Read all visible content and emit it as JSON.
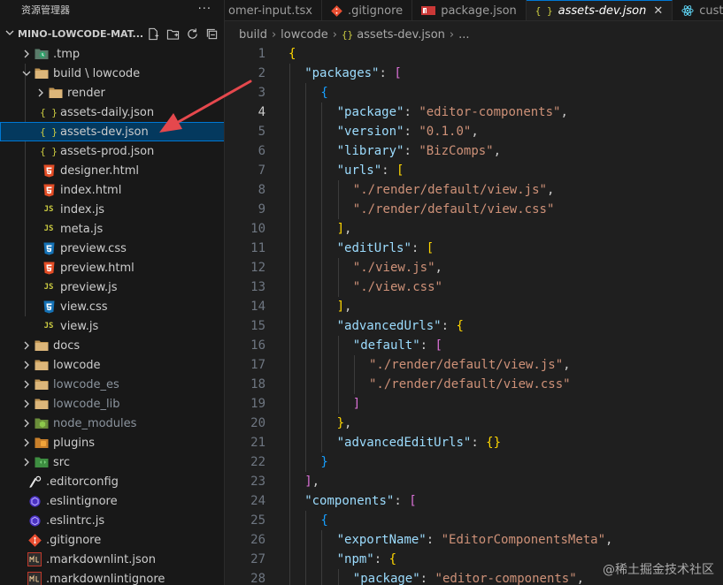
{
  "sidebar": {
    "title": "资源管理器",
    "more": "···",
    "root": "MINO-LOWCODE-MAT...",
    "items": [
      {
        "label": ".tmp",
        "level": 1,
        "icon": "tmp-folder-icon",
        "expanded": false,
        "dim": false
      },
      {
        "label": "build \\ lowcode",
        "level": 1,
        "icon": "folder-icon",
        "expanded": true,
        "dim": false
      },
      {
        "label": "render",
        "level": 2,
        "icon": "folder-icon",
        "expanded": false,
        "dim": false
      },
      {
        "label": "assets-daily.json",
        "level": 2,
        "icon": "json-icon",
        "dim": false
      },
      {
        "label": "assets-dev.json",
        "level": 2,
        "icon": "json-icon",
        "dim": false,
        "selected": true
      },
      {
        "label": "assets-prod.json",
        "level": 2,
        "icon": "json-icon",
        "dim": false
      },
      {
        "label": "designer.html",
        "level": 2,
        "icon": "html-icon",
        "dim": false
      },
      {
        "label": "index.html",
        "level": 2,
        "icon": "html-icon",
        "dim": false
      },
      {
        "label": "index.js",
        "level": 2,
        "icon": "js-icon",
        "dim": false
      },
      {
        "label": "meta.js",
        "level": 2,
        "icon": "js-icon",
        "dim": false
      },
      {
        "label": "preview.css",
        "level": 2,
        "icon": "css-icon",
        "dim": false
      },
      {
        "label": "preview.html",
        "level": 2,
        "icon": "html-icon",
        "dim": false
      },
      {
        "label": "preview.js",
        "level": 2,
        "icon": "js-icon",
        "dim": false
      },
      {
        "label": "view.css",
        "level": 2,
        "icon": "css-icon",
        "dim": false
      },
      {
        "label": "view.js",
        "level": 2,
        "icon": "js-icon",
        "dim": false
      },
      {
        "label": "docs",
        "level": 1,
        "icon": "folder-icon",
        "expanded": false,
        "dim": false
      },
      {
        "label": "lowcode",
        "level": 1,
        "icon": "folder-icon",
        "expanded": false,
        "dim": false
      },
      {
        "label": "lowcode_es",
        "level": 1,
        "icon": "folder-icon",
        "expanded": false,
        "dim": true
      },
      {
        "label": "lowcode_lib",
        "level": 1,
        "icon": "folder-icon",
        "expanded": false,
        "dim": true
      },
      {
        "label": "node_modules",
        "level": 1,
        "icon": "node-folder-icon",
        "expanded": false,
        "dim": true
      },
      {
        "label": "plugins",
        "level": 1,
        "icon": "plugin-folder-icon",
        "expanded": false,
        "dim": false
      },
      {
        "label": "src",
        "level": 1,
        "icon": "src-folder-icon",
        "expanded": false,
        "dim": false
      },
      {
        "label": ".editorconfig",
        "level": 1,
        "icon": "editorconfig-icon",
        "dim": false
      },
      {
        "label": ".eslintignore",
        "level": 1,
        "icon": "eslint-icon",
        "dim": false
      },
      {
        "label": ".eslintrc.js",
        "level": 1,
        "icon": "eslint-icon",
        "dim": false
      },
      {
        "label": ".gitignore",
        "level": 1,
        "icon": "git-icon",
        "dim": false
      },
      {
        "label": ".markdownlint.json",
        "level": 1,
        "icon": "markdownlint-icon",
        "dim": false
      },
      {
        "label": ".markdownlintignore",
        "level": 1,
        "icon": "markdownlint-icon",
        "dim": false
      }
    ]
  },
  "tabs": [
    {
      "label": "omer-input.tsx",
      "icon": "",
      "active": false
    },
    {
      "label": ".gitignore",
      "icon": "git-icon",
      "active": false
    },
    {
      "label": "package.json",
      "icon": "npm-icon",
      "active": false
    },
    {
      "label": "assets-dev.json",
      "icon": "json-icon",
      "active": true
    },
    {
      "label": "custo",
      "icon": "react-icon",
      "active": false
    }
  ],
  "breadcrumb": [
    "build",
    "lowcode",
    "assets-dev.json",
    "..."
  ],
  "editor": {
    "lines": [
      {
        "n": "1",
        "indent": 0,
        "tokens": [
          [
            "b1",
            "{"
          ]
        ]
      },
      {
        "n": "2",
        "indent": 1,
        "tokens": [
          [
            "k",
            "\"packages\""
          ],
          [
            "p",
            ": "
          ],
          [
            "b2",
            "["
          ]
        ]
      },
      {
        "n": "3",
        "indent": 2,
        "tokens": [
          [
            "b3",
            "{"
          ]
        ]
      },
      {
        "n": "4",
        "indent": 3,
        "tokens": [
          [
            "k",
            "\"package\""
          ],
          [
            "p",
            ": "
          ],
          [
            "s",
            "\"editor-components\""
          ],
          [
            "p",
            ","
          ]
        ]
      },
      {
        "n": "5",
        "indent": 3,
        "tokens": [
          [
            "k",
            "\"version\""
          ],
          [
            "p",
            ": "
          ],
          [
            "s",
            "\"0.1.0\""
          ],
          [
            "p",
            ","
          ]
        ]
      },
      {
        "n": "6",
        "indent": 3,
        "tokens": [
          [
            "k",
            "\"library\""
          ],
          [
            "p",
            ": "
          ],
          [
            "s",
            "\"BizComps\""
          ],
          [
            "p",
            ","
          ]
        ]
      },
      {
        "n": "7",
        "indent": 3,
        "tokens": [
          [
            "k",
            "\"urls\""
          ],
          [
            "p",
            ": "
          ],
          [
            "b1",
            "["
          ]
        ]
      },
      {
        "n": "8",
        "indent": 4,
        "tokens": [
          [
            "s",
            "\"./render/default/view.js\""
          ],
          [
            "p",
            ","
          ]
        ]
      },
      {
        "n": "9",
        "indent": 4,
        "tokens": [
          [
            "s",
            "\"./render/default/view.css\""
          ]
        ]
      },
      {
        "n": "10",
        "indent": 3,
        "tokens": [
          [
            "b1",
            "]"
          ],
          [
            "p",
            ","
          ]
        ]
      },
      {
        "n": "11",
        "indent": 3,
        "tokens": [
          [
            "k",
            "\"editUrls\""
          ],
          [
            "p",
            ": "
          ],
          [
            "b1",
            "["
          ]
        ]
      },
      {
        "n": "12",
        "indent": 4,
        "tokens": [
          [
            "s",
            "\"./view.js\""
          ],
          [
            "p",
            ","
          ]
        ]
      },
      {
        "n": "13",
        "indent": 4,
        "tokens": [
          [
            "s",
            "\"./view.css\""
          ]
        ]
      },
      {
        "n": "14",
        "indent": 3,
        "tokens": [
          [
            "b1",
            "]"
          ],
          [
            "p",
            ","
          ]
        ]
      },
      {
        "n": "15",
        "indent": 3,
        "tokens": [
          [
            "k",
            "\"advancedUrls\""
          ],
          [
            "p",
            ": "
          ],
          [
            "b1",
            "{"
          ]
        ]
      },
      {
        "n": "16",
        "indent": 4,
        "tokens": [
          [
            "k",
            "\"default\""
          ],
          [
            "p",
            ": "
          ],
          [
            "b2",
            "["
          ]
        ]
      },
      {
        "n": "17",
        "indent": 5,
        "tokens": [
          [
            "s",
            "\"./render/default/view.js\""
          ],
          [
            "p",
            ","
          ]
        ]
      },
      {
        "n": "18",
        "indent": 5,
        "tokens": [
          [
            "s",
            "\"./render/default/view.css\""
          ]
        ]
      },
      {
        "n": "19",
        "indent": 4,
        "tokens": [
          [
            "b2",
            "]"
          ]
        ]
      },
      {
        "n": "20",
        "indent": 3,
        "tokens": [
          [
            "b1",
            "}"
          ],
          [
            "p",
            ","
          ]
        ]
      },
      {
        "n": "21",
        "indent": 3,
        "tokens": [
          [
            "k",
            "\"advancedEditUrls\""
          ],
          [
            "p",
            ": "
          ],
          [
            "b1",
            "{}"
          ]
        ]
      },
      {
        "n": "22",
        "indent": 2,
        "tokens": [
          [
            "b3",
            "}"
          ]
        ]
      },
      {
        "n": "23",
        "indent": 1,
        "tokens": [
          [
            "b2",
            "]"
          ],
          [
            "p",
            ","
          ]
        ]
      },
      {
        "n": "24",
        "indent": 1,
        "tokens": [
          [
            "k",
            "\"components\""
          ],
          [
            "p",
            ": "
          ],
          [
            "b2",
            "["
          ]
        ]
      },
      {
        "n": "25",
        "indent": 2,
        "tokens": [
          [
            "b3",
            "{"
          ]
        ]
      },
      {
        "n": "26",
        "indent": 3,
        "tokens": [
          [
            "k",
            "\"exportName\""
          ],
          [
            "p",
            ": "
          ],
          [
            "s",
            "\"EditorComponentsMeta\""
          ],
          [
            "p",
            ","
          ]
        ]
      },
      {
        "n": "27",
        "indent": 3,
        "tokens": [
          [
            "k",
            "\"npm\""
          ],
          [
            "p",
            ": "
          ],
          [
            "b1",
            "{"
          ]
        ]
      },
      {
        "n": "28",
        "indent": 4,
        "tokens": [
          [
            "k",
            "\"package\""
          ],
          [
            "p",
            ": "
          ],
          [
            "s",
            "\"editor-components\""
          ],
          [
            "p",
            ","
          ]
        ]
      }
    ]
  },
  "watermark": "@稀土掘金技术社区",
  "colors": {
    "background": "#1f1f1f",
    "sidebar": "#181818",
    "selection": "#04395e",
    "accent": "#0078d4",
    "arrow": "#e5484d"
  }
}
